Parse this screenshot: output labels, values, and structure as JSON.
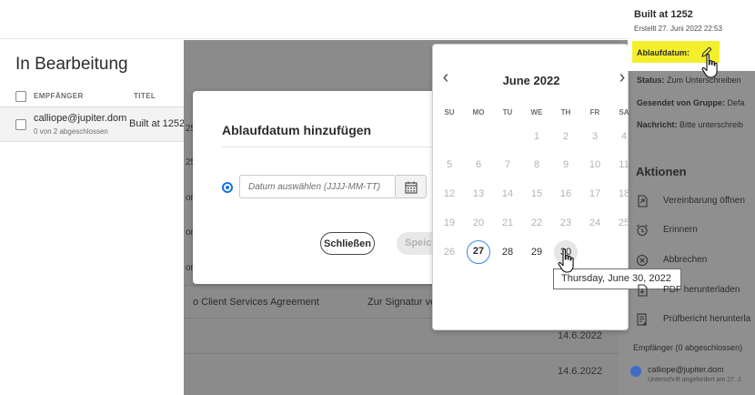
{
  "list": {
    "title": "In Bearbeitung",
    "columns": {
      "recipient": "EMPFÄNGER",
      "title": "TITEL"
    },
    "row": {
      "email": "calliope@jupiter.dom",
      "progress": "0 von 2 abgeschlossen",
      "title": "Built at 1252"
    }
  },
  "background": {
    "fragments": [
      "25",
      "25",
      "orp",
      "orp",
      "orp"
    ],
    "agreement_link": "o Client Services Agreement",
    "agreement_status": "Zur Signatur ver",
    "dates": [
      "14.6.2022",
      "14.6.2022"
    ]
  },
  "dialog": {
    "title": "Ablaufdatum hinzufügen",
    "date_placeholder": "Datum auswählen (JJJJ-MM-TT)",
    "close_label": "Schließen",
    "save_label": "Speich"
  },
  "calendar": {
    "month_label": "June 2022",
    "prev_label": "‹",
    "next_label": "›",
    "weekdays": [
      "SU",
      "MO",
      "TU",
      "WE",
      "TH",
      "FR",
      "SA"
    ],
    "rows": [
      [
        "",
        "",
        "",
        "1",
        "2",
        "3",
        "4"
      ],
      [
        "5",
        "6",
        "7",
        "8",
        "9",
        "10",
        "11"
      ],
      [
        "12",
        "13",
        "14",
        "15",
        "16",
        "17",
        "18"
      ],
      [
        "19",
        "20",
        "21",
        "22",
        "23",
        "24",
        "25"
      ],
      [
        "26",
        "27",
        "28",
        "29",
        "30",
        "",
        ""
      ]
    ],
    "today": "27",
    "hovered": "30",
    "enabled": [
      "27",
      "28",
      "29",
      "30"
    ],
    "tooltip": "Thursday, June 30, 2022"
  },
  "details": {
    "title": "Built at 1252",
    "created": "Erstellt 27. Juni 2022 22:53",
    "expiry_label": "Ablaufdatum:",
    "status_label": "Status:",
    "status_value": "Zum Unterschreiben",
    "sent_by_label": "Gesendet von Gruppe:",
    "sent_by_value": "Defa",
    "message_label": "Nachricht:",
    "message_value": "Bitte unterschreib",
    "actions_title": "Aktionen",
    "actions": [
      "Vereinbarung öffnen",
      "Erinnern",
      "Abbrechen",
      "PDF herunterladen",
      "Prüfbericht herunterla"
    ],
    "recipients_header": "Empfänger (0 abgeschlossen)",
    "recipient_email": "calliope@jupiter.dom",
    "recipient_sub": "Unterschrift angefordert am 27. J"
  },
  "colors": {
    "accent": "#1473e6",
    "highlight": "#f4ef2c",
    "overlay": "#8b8b8b"
  }
}
